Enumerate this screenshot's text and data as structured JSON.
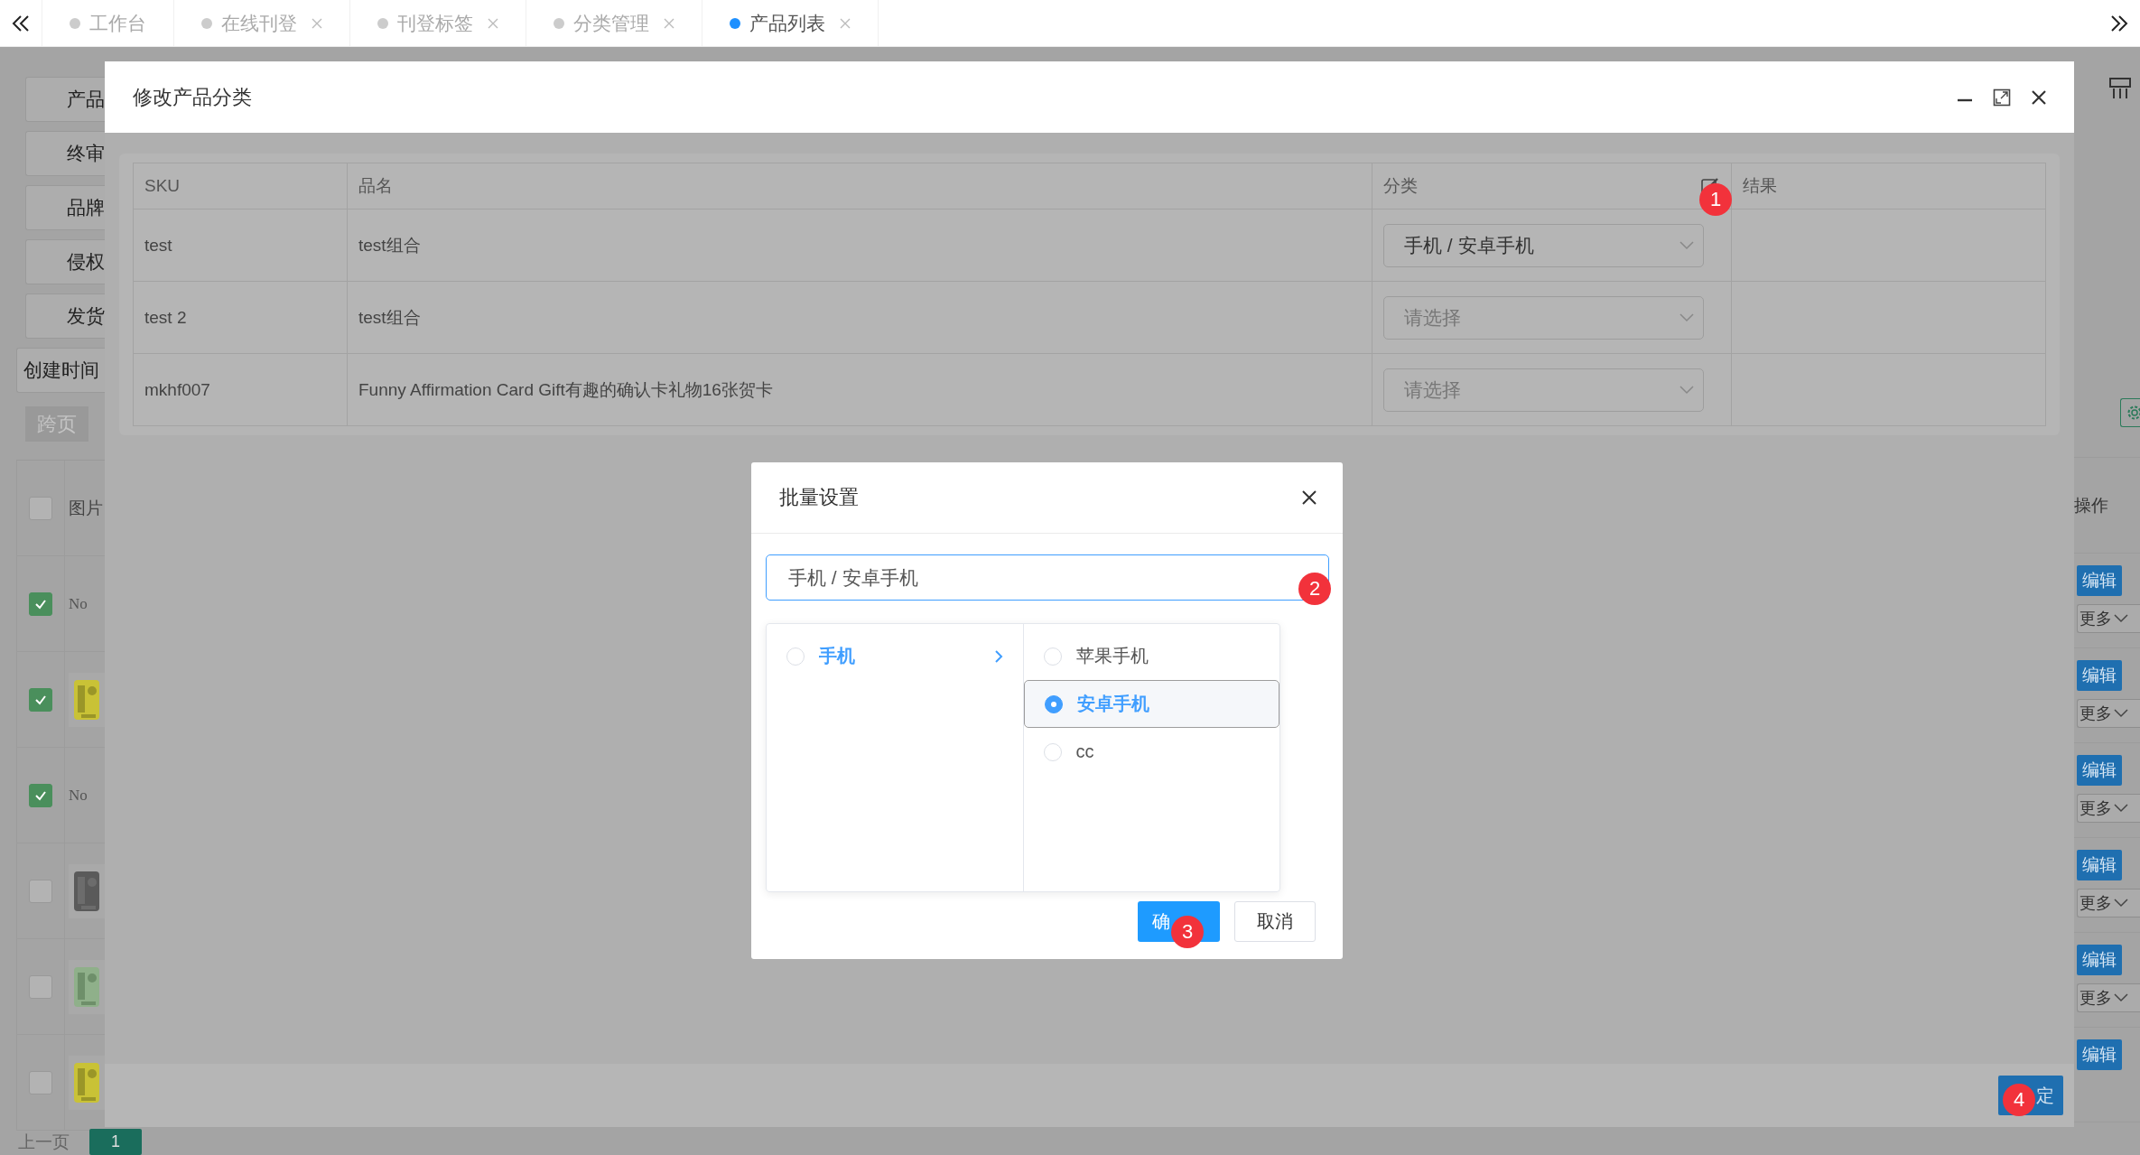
{
  "tab_bar": {
    "tabs": [
      {
        "label": "工作台",
        "closable": false,
        "selected": false
      },
      {
        "label": "在线刊登",
        "closable": true,
        "selected": false
      },
      {
        "label": "刊登标签",
        "closable": true,
        "selected": false
      },
      {
        "label": "分类管理",
        "closable": true,
        "selected": false
      },
      {
        "label": "产品列表",
        "closable": true,
        "selected": true
      }
    ]
  },
  "product_list": {
    "filters": [
      "产品",
      "终审",
      "品牌",
      "侵权",
      "发货",
      "创建时间"
    ],
    "cross_page_button": "跨页",
    "image_column": "图片",
    "header_checked": false,
    "rows": [
      {
        "checked": true,
        "kind": "no_image",
        "text": "No"
      },
      {
        "checked": true,
        "kind": "picture"
      },
      {
        "checked": true,
        "kind": "no_image",
        "text": "No"
      },
      {
        "checked": false,
        "kind": "picture"
      },
      {
        "checked": false,
        "kind": "picture"
      },
      {
        "checked": false,
        "kind": "picture"
      }
    ],
    "operations_column": "操作",
    "operations": [
      {
        "edit": "编辑",
        "more": "更多"
      },
      {
        "edit": "编辑",
        "more": "更多"
      },
      {
        "edit": "编辑",
        "more": "更多"
      },
      {
        "edit": "编辑",
        "more": "更多"
      },
      {
        "edit": "编辑",
        "more": "更多"
      },
      {
        "edit": "编辑"
      }
    ],
    "pagination": {
      "previous": "上一页",
      "current_page": "1"
    }
  },
  "category_dialog": {
    "title": "修改产品分类",
    "columns": [
      "SKU",
      "品名",
      "分类",
      "结果"
    ],
    "rows": [
      {
        "sku": "test",
        "name": "test组合",
        "category": "手机 / 安卓手机"
      },
      {
        "sku": "test 2",
        "name": "test组合",
        "placeholder": "请选择"
      },
      {
        "sku": "mkhf007",
        "name": "Funny Affirmation Card Gift有趣的确认卡礼物16张贺卡",
        "placeholder": "请选择"
      }
    ],
    "confirm_button": "定"
  },
  "batch_dialog": {
    "title": "批量设置",
    "value": "手机 / 安卓手机",
    "columns": [
      {
        "options": [
          {
            "label": "手机",
            "selected": false,
            "expanded": true
          }
        ]
      },
      {
        "options": [
          {
            "label": "苹果手机",
            "selected": false
          },
          {
            "label": "安卓手机",
            "selected": true
          },
          {
            "label": "cc",
            "selected": false
          }
        ]
      }
    ],
    "confirm_button": "确",
    "cancel_button": "取消"
  },
  "step_badges": [
    "1",
    "2",
    "3",
    "4"
  ]
}
